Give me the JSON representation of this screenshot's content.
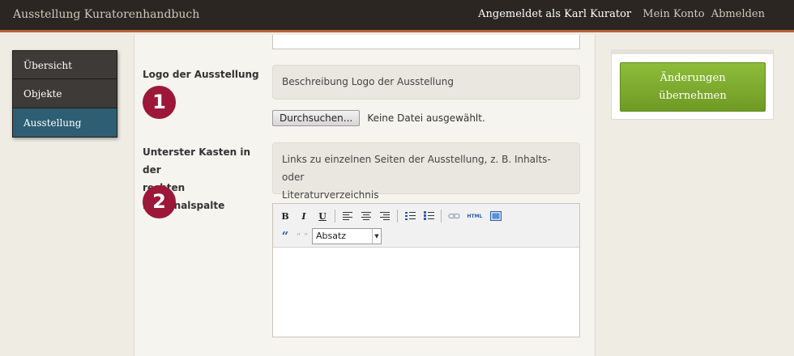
{
  "header": {
    "app_title": "Ausstellung Kuratorenhandbuch",
    "logged_in": "Angemeldet als Karl Kurator",
    "account_link": "Mein Konto",
    "logout_link": "Abmelden"
  },
  "nav": {
    "items": [
      {
        "label": "Übersicht",
        "active": false
      },
      {
        "label": "Objekte",
        "active": false
      },
      {
        "label": "Ausstellung",
        "active": true
      }
    ]
  },
  "form": {
    "logo": {
      "label": "Logo der Ausstellung",
      "badge": "1",
      "help": "Beschreibung Logo der Ausstellung",
      "browse_button": "Durchsuchen...",
      "file_status": "Keine Datei ausgewählt."
    },
    "sidebar_box": {
      "label_line1": "Unterster Kasten in der",
      "label_line2": "rechten Marginalspalte",
      "badge": "2",
      "help_line1": "Links zu einzelnen Seiten der Ausstellung, z. B. Inhalts- oder",
      "help_line2": "Literaturverzeichnis"
    },
    "editor": {
      "bold": "B",
      "italic": "I",
      "underline": "U",
      "html_label": "HTML",
      "format_select": "Absatz",
      "content": ""
    }
  },
  "actions": {
    "save_line1": "Änderungen",
    "save_line2": "übernehmen"
  },
  "colors": {
    "topbar": "#2b2622",
    "topbar_accent": "#b9603c",
    "nav_active": "#2e5e73",
    "badge": "#9c1738",
    "save_button": "#7ba82c"
  }
}
